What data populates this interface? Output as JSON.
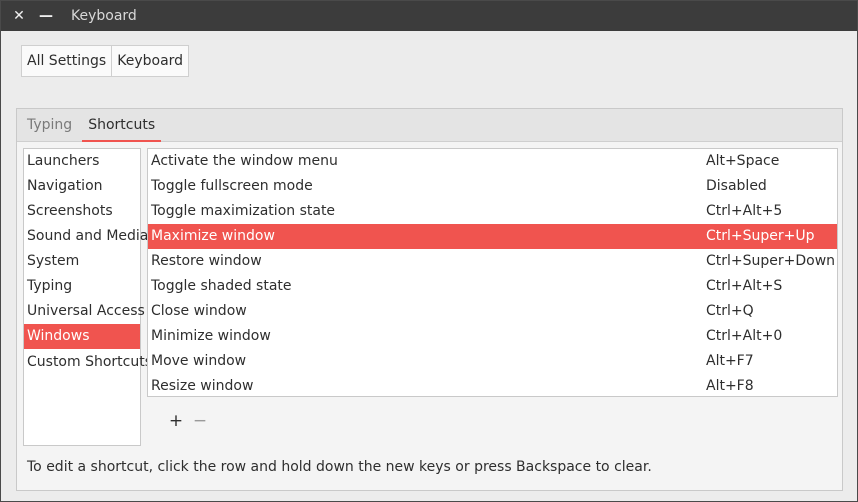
{
  "window": {
    "title": "Keyboard",
    "close_glyph": "✕",
    "minimize_glyph": "—"
  },
  "breadcrumb": {
    "items": [
      "All Settings",
      "Keyboard"
    ]
  },
  "tabs": [
    {
      "label": "Typing",
      "active": false
    },
    {
      "label": "Shortcuts",
      "active": true
    }
  ],
  "categories": [
    "Launchers",
    "Navigation",
    "Screenshots",
    "Sound and Media",
    "System",
    "Typing",
    "Universal Access",
    "Windows",
    "Custom Shortcuts"
  ],
  "selected_category": "Windows",
  "shortcuts": [
    {
      "name": "Activate the window menu",
      "accel": "Alt+Space"
    },
    {
      "name": "Toggle fullscreen mode",
      "accel": "Disabled"
    },
    {
      "name": "Toggle maximization state",
      "accel": "Ctrl+Alt+5"
    },
    {
      "name": "Maximize window",
      "accel": "Ctrl+Super+Up"
    },
    {
      "name": "Restore window",
      "accel": "Ctrl+Super+Down"
    },
    {
      "name": "Toggle shaded state",
      "accel": "Ctrl+Alt+S"
    },
    {
      "name": "Close window",
      "accel": "Ctrl+Q"
    },
    {
      "name": "Minimize window",
      "accel": "Ctrl+Alt+0"
    },
    {
      "name": "Move window",
      "accel": "Alt+F7"
    },
    {
      "name": "Resize window",
      "accel": "Alt+F8"
    }
  ],
  "selected_shortcut": "Maximize window",
  "actions": {
    "add_glyph": "+",
    "remove_glyph": "−"
  },
  "hint": "To edit a shortcut, click the row and hold down the new keys or press Backspace to clear.",
  "colors": {
    "accent": "#f0544f",
    "titlebar": "#3c3c3c"
  }
}
